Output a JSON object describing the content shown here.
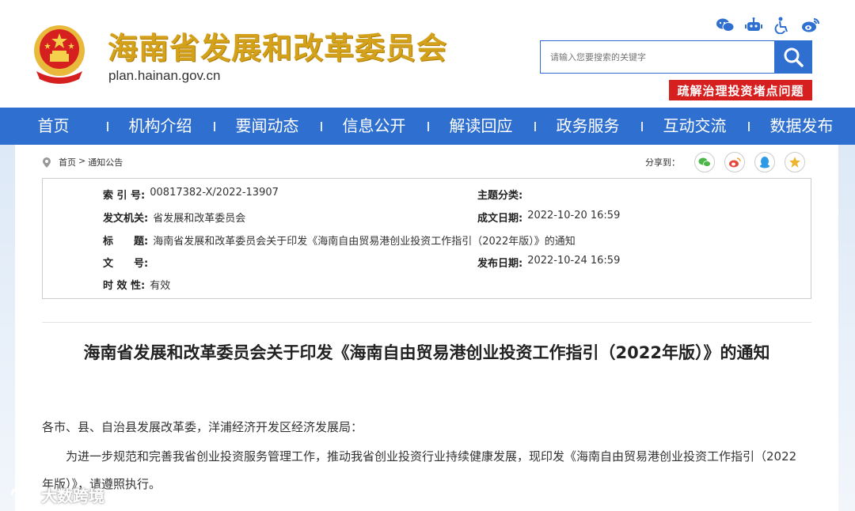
{
  "header": {
    "site_title": "海南省发展和改革委员会",
    "site_url": "plan.hainan.gov.cn",
    "search_placeholder": "请输入您要搜索的关键字",
    "promo_button": "疏解治理投资堵点问题",
    "icons": [
      "wechat-icon",
      "robot-icon",
      "accessibility-icon",
      "weibo-icon"
    ]
  },
  "nav": {
    "items": [
      "首页",
      "机构介绍",
      "要闻动态",
      "信息公开",
      "解读回应",
      "政务服务",
      "互动交流",
      "数据发布"
    ]
  },
  "breadcrumb": {
    "home": "首页",
    "separator": ">",
    "current": "通知公告"
  },
  "share": {
    "label": "分享到："
  },
  "info": {
    "index_label": "索 引 号:",
    "index_value": "00817382-X/2022-13907",
    "topic_label": "主题分类:",
    "topic_value": "",
    "issuer_label": "发文机关:",
    "issuer_value": "省发展和改革委员会",
    "created_label": "成文日期:",
    "created_value": "2022-10-20 16:59",
    "title_label": "标　　题:",
    "title_value": "海南省发展和改革委员会关于印发《海南自由贸易港创业投资工作指引（2022年版）》的通知",
    "docno_label": "文　　号:",
    "docno_value": "",
    "published_label": "发布日期:",
    "published_value": "2022-10-24 16:59",
    "validity_label": "时 效 性:",
    "validity_value": "有效"
  },
  "document": {
    "title": "海南省发展和改革委员会关于印发《海南自由贸易港创业投资工作指引（2022年版）》的通知",
    "salutation": "各市、县、自治县发展改革委，洋浦经济开发区经济发展局：",
    "para1_line1": "为进一步规范和完善我省创业投资服务管理工作，推动我省创业投资行业持续健康发展，现印发《海南自由贸易港创业投资工作指引（2022",
    "para1_line2": "年版）》，请遵照执行。"
  },
  "watermark": "大数跨境",
  "colors": {
    "nav_blue": "#2e6fd0",
    "promo_red": "#d6201f",
    "title_gold": "#d4a21a"
  }
}
